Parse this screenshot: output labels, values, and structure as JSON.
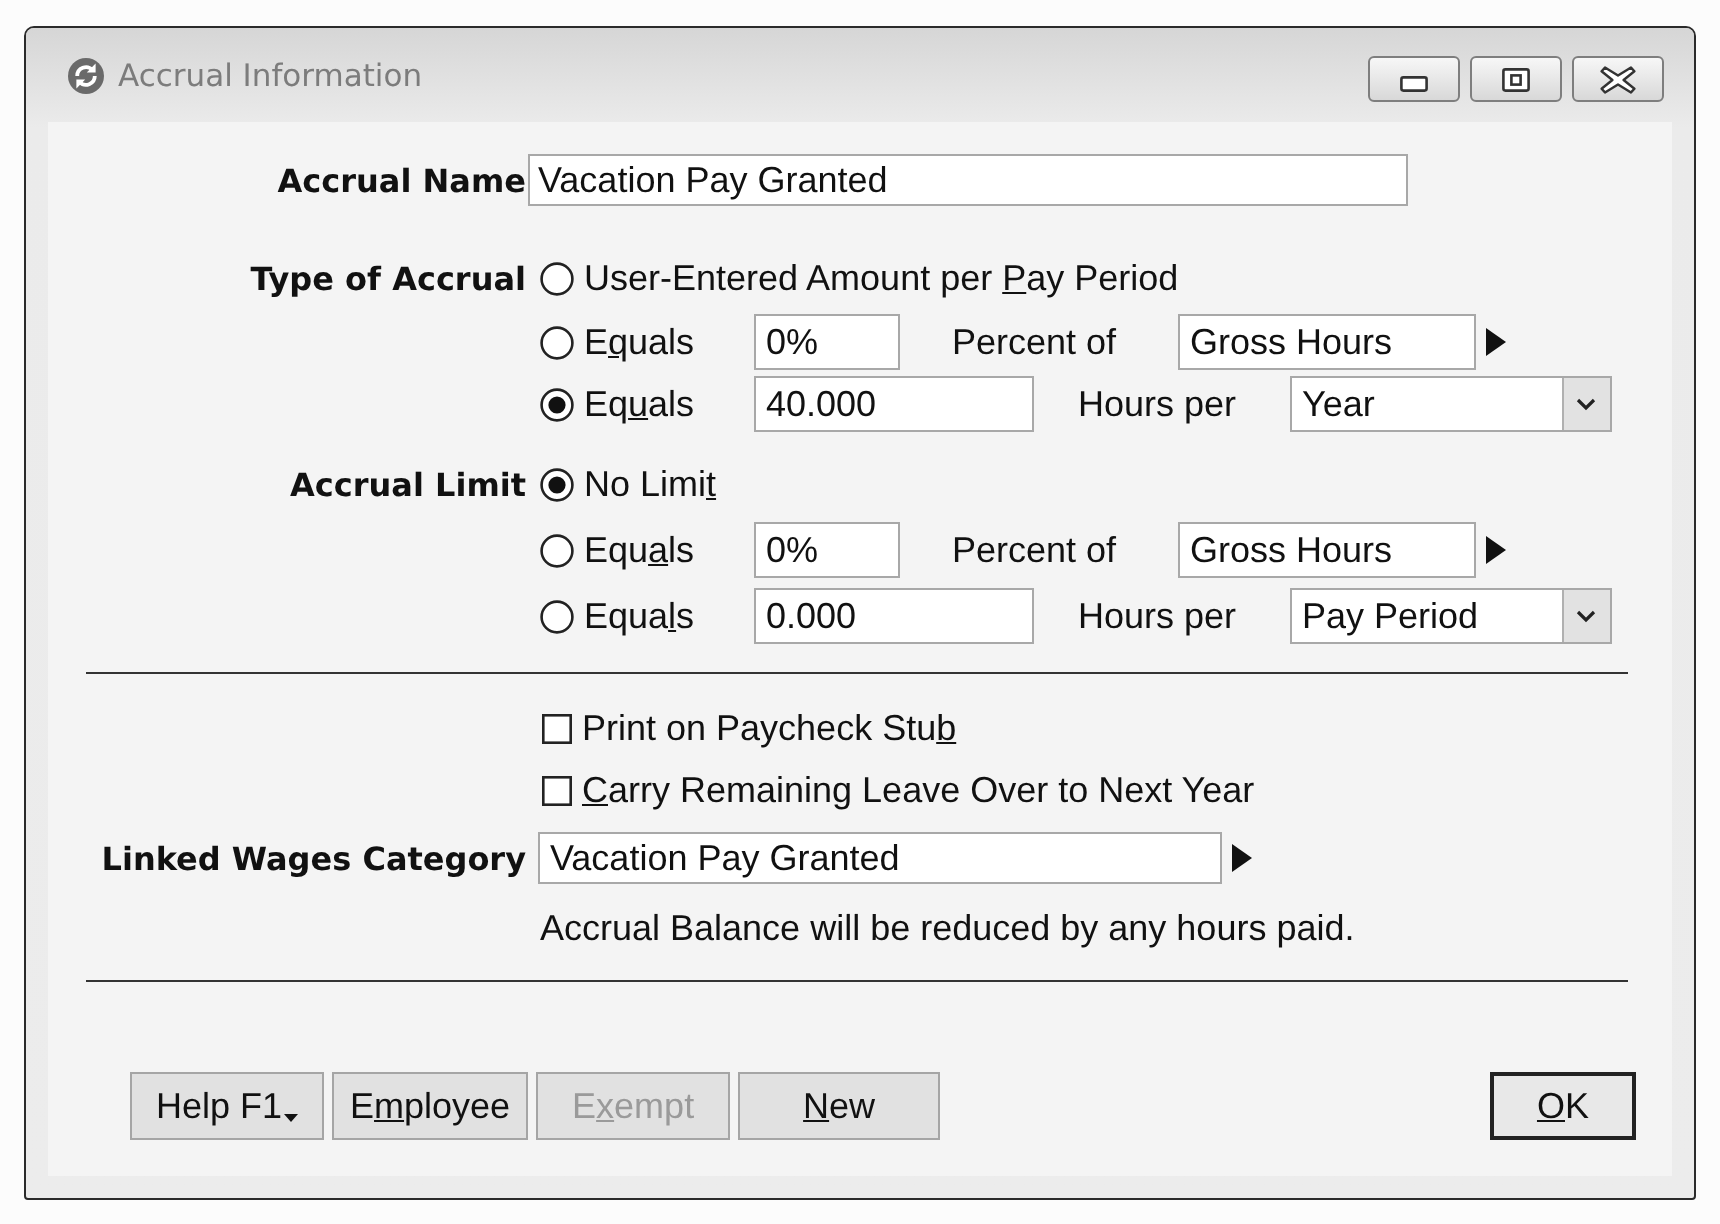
{
  "window": {
    "title": "Accrual Information"
  },
  "accrual_name": {
    "label": "Accrual Name",
    "value": "Vacation Pay Granted"
  },
  "type_of_accrual": {
    "label": "Type of Accrual",
    "options": [
      {
        "kind": "plain",
        "selected": false,
        "label": {
          "pre": "User-Entered Amount per ",
          "key": "P",
          "post": "ay Period"
        }
      },
      {
        "kind": "percent",
        "selected": false,
        "label": {
          "pre": "E",
          "key": "q",
          "post": "uals"
        },
        "value": "0%",
        "unit_label": "Percent of",
        "basis": "Gross Hours"
      },
      {
        "kind": "hours",
        "selected": true,
        "label": {
          "pre": "Eq",
          "key": "u",
          "post": "als"
        },
        "value": "40.000",
        "unit_label": "Hours per",
        "period": "Year"
      }
    ]
  },
  "accrual_limit": {
    "label": "Accrual Limit",
    "options": [
      {
        "kind": "plain",
        "selected": true,
        "label": {
          "pre": "No Limi",
          "key": "t"
        }
      },
      {
        "kind": "percent",
        "selected": false,
        "label": {
          "pre": "Equ",
          "key": "a",
          "post": "ls"
        },
        "value": "0%",
        "unit_label": "Percent of",
        "basis": "Gross Hours"
      },
      {
        "kind": "hours",
        "selected": false,
        "label": {
          "pre": "Equa",
          "key": "l",
          "post": "s"
        },
        "value": "0.000",
        "unit_label": "Hours per",
        "period": "Pay Period"
      }
    ]
  },
  "checkboxes": [
    {
      "checked": false,
      "label": {
        "pre": "Print on Paycheck Stu",
        "key": "b"
      }
    },
    {
      "checked": false,
      "label": {
        "key": "C",
        "post": "arry Remaining Leave Over to Next Year"
      }
    }
  ],
  "linked_wages": {
    "label": "Linked Wages Category",
    "value": "Vacation Pay Granted",
    "note": "Accrual Balance will be reduced by any hours paid."
  },
  "buttons": [
    {
      "kind": "menu",
      "disabled": false,
      "label": {
        "pre": "Help F1"
      }
    },
    {
      "kind": "push",
      "disabled": false,
      "label": {
        "pre": "E",
        "key": "m",
        "post": "ployee"
      }
    },
    {
      "kind": "push",
      "disabled": true,
      "label": {
        "pre": "E",
        "key": "x",
        "post": "empt"
      }
    },
    {
      "kind": "push",
      "disabled": false,
      "label": {
        "key": "N",
        "post": "ew"
      }
    },
    {
      "kind": "default",
      "disabled": false,
      "label": {
        "key": "O",
        "post": "K"
      }
    }
  ]
}
